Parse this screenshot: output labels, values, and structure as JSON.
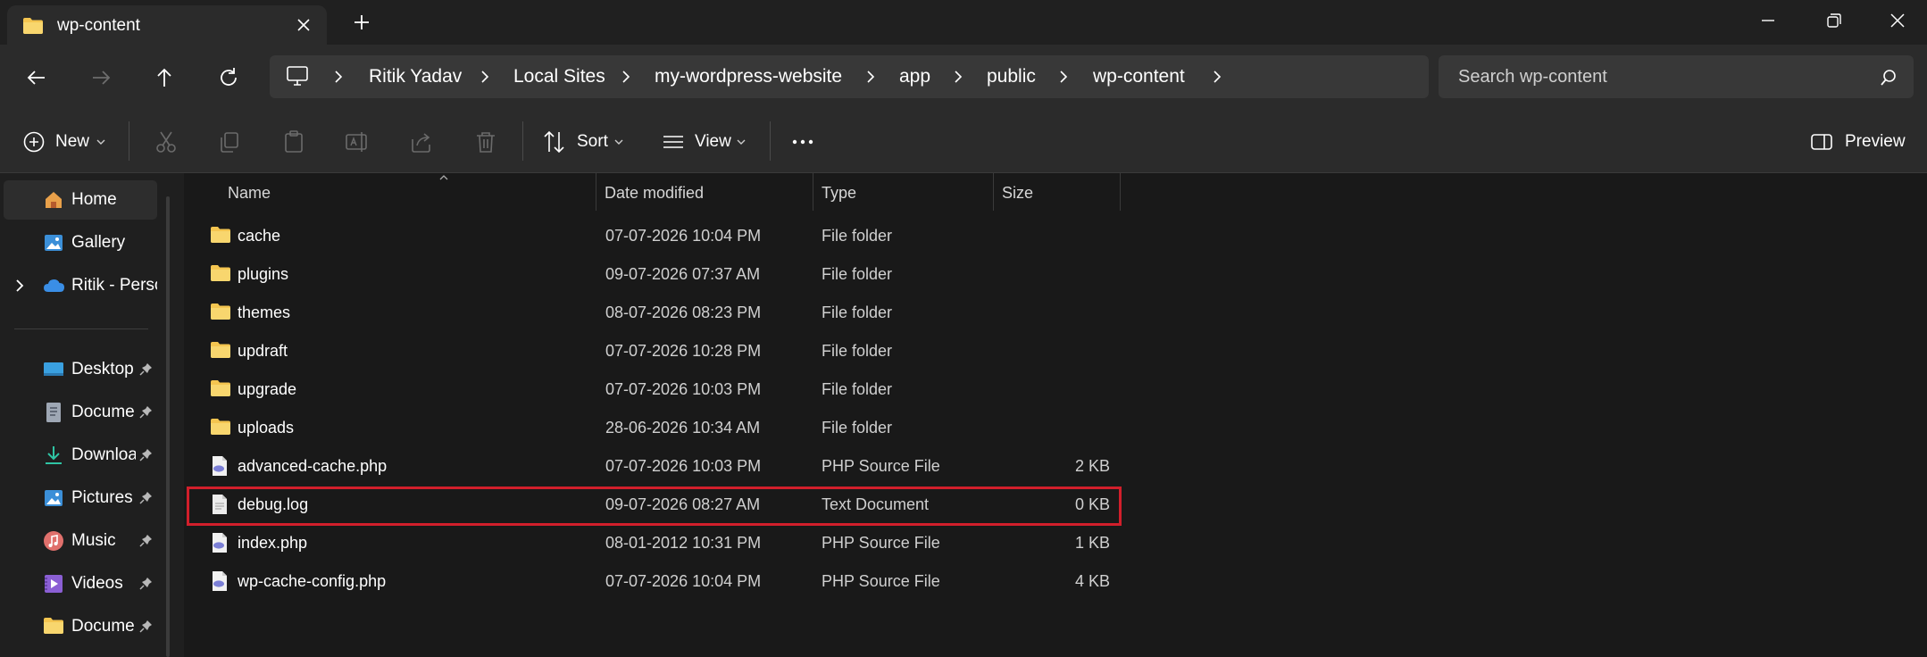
{
  "window": {
    "tab_title": "wp-content",
    "colors": {
      "accent_highlight": "#d21f2b",
      "folder": "#f4c550",
      "php_icon": "#7b7fd6"
    }
  },
  "address": {
    "breadcrumbs": [
      "Ritik Yadav",
      "Local Sites",
      "my-wordpress-website",
      "app",
      "public",
      "wp-content"
    ],
    "search_placeholder": "Search wp-content"
  },
  "toolbar": {
    "new_label": "New",
    "sort_label": "Sort",
    "view_label": "View",
    "preview_label": "Preview"
  },
  "sidebar": {
    "items": [
      {
        "label": "Home",
        "icon": "home-icon",
        "selected": true
      },
      {
        "label": "Gallery",
        "icon": "gallery-icon"
      },
      {
        "label": "Ritik - Persor",
        "icon": "onedrive-cloud-icon",
        "expandable": true
      }
    ],
    "pinned": [
      {
        "label": "Desktop",
        "icon": "desktop-icon"
      },
      {
        "label": "Documer",
        "icon": "documents-icon"
      },
      {
        "label": "Downloa",
        "icon": "downloads-icon"
      },
      {
        "label": "Pictures",
        "icon": "pictures-icon"
      },
      {
        "label": "Music",
        "icon": "music-icon"
      },
      {
        "label": "Videos",
        "icon": "videos-icon"
      },
      {
        "label": "Documer",
        "icon": "folder-icon"
      }
    ]
  },
  "files": {
    "columns": [
      "Name",
      "Date modified",
      "Type",
      "Size"
    ],
    "rows": [
      {
        "name": "cache",
        "date": "07-07-2026 10:04 PM",
        "type": "File folder",
        "size": "",
        "kind": "folder"
      },
      {
        "name": "plugins",
        "date": "09-07-2026 07:37 AM",
        "type": "File folder",
        "size": "",
        "kind": "folder"
      },
      {
        "name": "themes",
        "date": "08-07-2026 08:23 PM",
        "type": "File folder",
        "size": "",
        "kind": "folder"
      },
      {
        "name": "updraft",
        "date": "07-07-2026 10:28 PM",
        "type": "File folder",
        "size": "",
        "kind": "folder"
      },
      {
        "name": "upgrade",
        "date": "07-07-2026 10:03 PM",
        "type": "File folder",
        "size": "",
        "kind": "folder"
      },
      {
        "name": "uploads",
        "date": "28-06-2026 10:34 AM",
        "type": "File folder",
        "size": "",
        "kind": "folder"
      },
      {
        "name": "advanced-cache.php",
        "date": "07-07-2026 10:03 PM",
        "type": "PHP Source File",
        "size": "2 KB",
        "kind": "php"
      },
      {
        "name": "debug.log",
        "date": "09-07-2026 08:27 AM",
        "type": "Text Document",
        "size": "0 KB",
        "kind": "text",
        "highlighted": true
      },
      {
        "name": "index.php",
        "date": "08-01-2012 10:31 PM",
        "type": "PHP Source File",
        "size": "1 KB",
        "kind": "php"
      },
      {
        "name": "wp-cache-config.php",
        "date": "07-07-2026 10:04 PM",
        "type": "PHP Source File",
        "size": "4 KB",
        "kind": "php"
      }
    ]
  }
}
